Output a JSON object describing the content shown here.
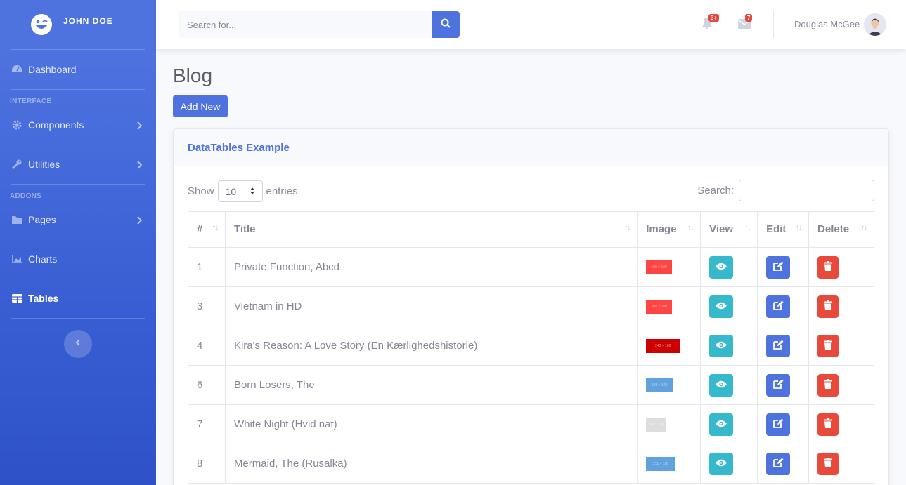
{
  "sidebar": {
    "brand": "JOHN DOE",
    "dashboard": "Dashboard",
    "heading_interface": "INTERFACE",
    "components": "Components",
    "utilities": "Utilities",
    "heading_addons": "ADDONS",
    "pages": "Pages",
    "charts": "Charts",
    "tables": "Tables"
  },
  "topbar": {
    "search_placeholder": "Search for...",
    "alerts_badge": "3+",
    "messages_badge": "7",
    "user_name": "Douglas McGee"
  },
  "page": {
    "title": "Blog",
    "add_button": "Add New"
  },
  "card": {
    "header": "DataTables Example",
    "show_label": "Show",
    "entries_value": "10",
    "entries_label": "entries",
    "search_label": "Search:"
  },
  "table": {
    "columns": [
      "#",
      "Title",
      "Image",
      "View",
      "Edit",
      "Delete"
    ],
    "rows": [
      {
        "id": "1",
        "title": "Private Function, Abcd",
        "thumb_color": "#ff4444",
        "thumb_text": "160 × 100"
      },
      {
        "id": "3",
        "title": "Vietnam in HD",
        "thumb_color": "#ff4444",
        "thumb_text": "160 × 100"
      },
      {
        "id": "4",
        "title": "Kira's Reason: A Love Story (En Kærlighedshistorie)",
        "thumb_color": "#cc0000",
        "thumb_text": "243 × 100"
      },
      {
        "id": "6",
        "title": "Born Losers, The",
        "thumb_color": "#5fa2dd",
        "thumb_text": "193 × 100"
      },
      {
        "id": "7",
        "title": "White Night (Hvid nat)",
        "thumb_color": "#dddddd",
        "thumb_text": "140 × 100"
      },
      {
        "id": "8",
        "title": "Mermaid, The (Rusalka)",
        "thumb_color": "#5fa2dd",
        "thumb_text": "211 × 100"
      }
    ]
  },
  "colors": {
    "primary": "#4e73df",
    "info": "#36b9cc",
    "danger": "#e74a3b"
  }
}
